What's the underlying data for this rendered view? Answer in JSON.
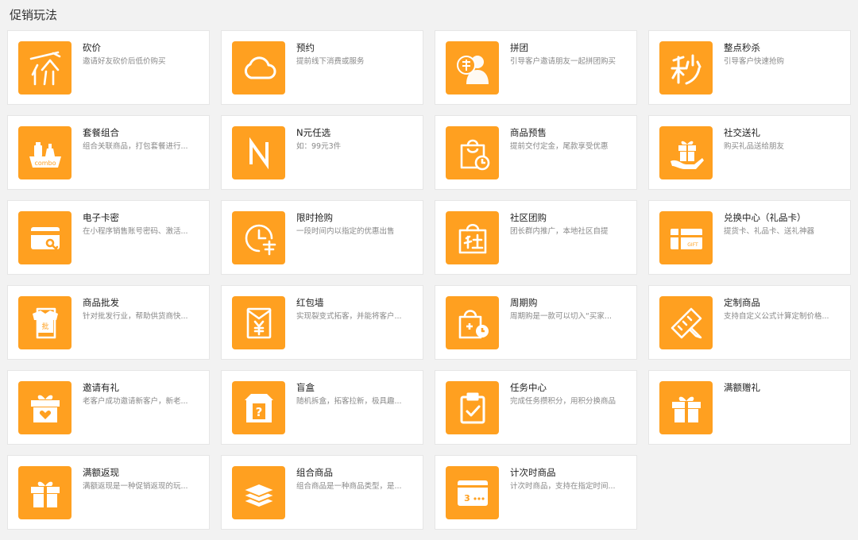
{
  "page": {
    "title": "促销玩法"
  },
  "theme": {
    "accent": "#ffa020"
  },
  "cards": [
    {
      "title": "砍价",
      "desc": "邀请好友砍价后低价购买",
      "icon": "bargain-icon"
    },
    {
      "title": "预约",
      "desc": "提前线下消费或服务",
      "icon": "cloud-icon"
    },
    {
      "title": "拼团",
      "desc": "引导客户邀请朋友一起拼团购买",
      "icon": "group-buy-icon"
    },
    {
      "title": "整点秒杀",
      "desc": "引导客户快速抢购",
      "icon": "flash-sale-icon"
    },
    {
      "title": "套餐组合",
      "desc": "组合关联商品，打包套餐进行...",
      "icon": "combo-icon"
    },
    {
      "title": "N元任选",
      "desc": "如：99元3件",
      "icon": "n-letter-icon"
    },
    {
      "title": "商品预售",
      "desc": "提前交付定金，尾款享受优惠",
      "icon": "presale-bag-icon"
    },
    {
      "title": "社交送礼",
      "desc": "购买礼品送给朋友",
      "icon": "gift-hand-icon"
    },
    {
      "title": "电子卡密",
      "desc": "在小程序销售账号密码、激活...",
      "icon": "ecard-key-icon"
    },
    {
      "title": "限时抢购",
      "desc": "一段时间内以指定的优惠出售",
      "icon": "clock-grab-icon"
    },
    {
      "title": "社区团购",
      "desc": "团长群内推广，本地社区自提",
      "icon": "community-bag-icon"
    },
    {
      "title": "兑换中心（礼品卡）",
      "desc": "提货卡、礼品卡、送礼神器",
      "icon": "gift-card-icon"
    },
    {
      "title": "商品批发",
      "desc": "针对批发行业，帮助供货商快...",
      "icon": "wholesale-shirt-icon"
    },
    {
      "title": "红包墙",
      "desc": "实现裂变式拓客，并能将客户...",
      "icon": "red-envelope-icon"
    },
    {
      "title": "周期购",
      "desc": "周期购是一款可以切入“买家...",
      "icon": "cycle-bag-icon"
    },
    {
      "title": "定制商品",
      "desc": "支持自定义公式计算定制价格...",
      "icon": "ruler-pencil-icon"
    },
    {
      "title": "邀请有礼",
      "desc": "老客户成功邀请新客户，新老...",
      "icon": "invite-gift-icon"
    },
    {
      "title": "盲盒",
      "desc": "随机拆盒，拓客拉新，极具趣...",
      "icon": "blind-box-icon"
    },
    {
      "title": "任务中心",
      "desc": "完成任务攒积分，用积分换商品",
      "icon": "task-clipboard-icon"
    },
    {
      "title": "满额赠礼",
      "desc": "",
      "icon": "gift-box-icon"
    },
    {
      "title": "满额返现",
      "desc": "满额返现是一种促销返现的玩...",
      "icon": "cashback-gift-icon"
    },
    {
      "title": "组合商品",
      "desc": "组合商品是一种商品类型，是...",
      "icon": "layers-icon"
    },
    {
      "title": "计次时商品",
      "desc": "计次时商品，支持在指定时间...",
      "icon": "count-card-icon"
    }
  ]
}
